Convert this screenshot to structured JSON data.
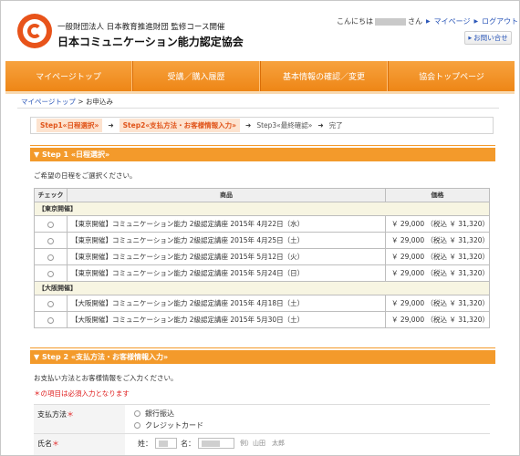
{
  "header": {
    "org_sub": "一般財団法人 日本教育推進財団 監修コース開催",
    "org_name": "日本コミュニケーション能力認定協会",
    "greeting_prefix": "こんにちは",
    "greeting_suffix": "さん",
    "mypage_link": "マイページ",
    "logout_link": "ログアウト",
    "contact_button": "お問い合せ"
  },
  "nav": {
    "items": [
      {
        "label": "マイページトップ"
      },
      {
        "label": "受講／購入履歴"
      },
      {
        "label": "基本情報の確認／変更"
      },
      {
        "label": "協会トップページ"
      }
    ]
  },
  "breadcrumb": {
    "home": "マイページトップ",
    "separator": ">",
    "current": "お申込み"
  },
  "steps": {
    "step1": "Step1«日程選択»",
    "step2": "Step2«支払方法・お客様情報入力»",
    "step3": "Step3«最終確認»",
    "step4": "完了",
    "arrow": "➜"
  },
  "section1": {
    "title": "▼ Step 1 «日程選択»",
    "instruction": "ご希望の日程をご選択ください。",
    "columns": {
      "check": "チェック",
      "product": "商品",
      "price": "価格"
    },
    "regions": [
      {
        "name": "【東京開催】",
        "rows": [
          {
            "product": "【東京開催】コミュニケーション能力 2級認定講座 2015年 4月22日（水）",
            "price": "￥ 29,000 （税込 ￥ 31,320）"
          },
          {
            "product": "【東京開催】コミュニケーション能力 2級認定講座 2015年 4月25日（土）",
            "price": "￥ 29,000 （税込 ￥ 31,320）"
          },
          {
            "product": "【東京開催】コミュニケーション能力 2級認定講座 2015年 5月12日（火）",
            "price": "￥ 29,000 （税込 ￥ 31,320）"
          },
          {
            "product": "【東京開催】コミュニケーション能力 2級認定講座 2015年 5月24日（日）",
            "price": "￥ 29,000 （税込 ￥ 31,320）"
          }
        ]
      },
      {
        "name": "【大阪開催】",
        "rows": [
          {
            "product": "【大阪開催】コミュニケーション能力 2級認定講座 2015年 4月18日（土）",
            "price": "￥ 29,000 （税込 ￥ 31,320）"
          },
          {
            "product": "【大阪開催】コミュニケーション能力 2級認定講座 2015年 5月30日（土）",
            "price": "￥ 29,000 （税込 ￥ 31,320）"
          }
        ]
      }
    ]
  },
  "section2": {
    "title": "▼ Step 2 «支払方法・お客様情報入力»",
    "instruction": "お支払い方法とお客様情報をご入力ください。",
    "required_note": "＊の項目は必須入力となります",
    "payment": {
      "label": "支払方法",
      "required_mark": "＊",
      "options": [
        "銀行振込",
        "クレジットカード"
      ]
    },
    "name": {
      "label": "氏名",
      "required_mark": "＊",
      "last_label": "姓：",
      "first_label": "名：",
      "example": "例）山田　太郎"
    }
  },
  "colors": {
    "accent": "#f39a2b",
    "nav": "#ee8616",
    "link": "#2a56b8",
    "required": "#e02020",
    "step_highlight_bg": "#fde3cf",
    "step_highlight_text": "#e0541a"
  }
}
